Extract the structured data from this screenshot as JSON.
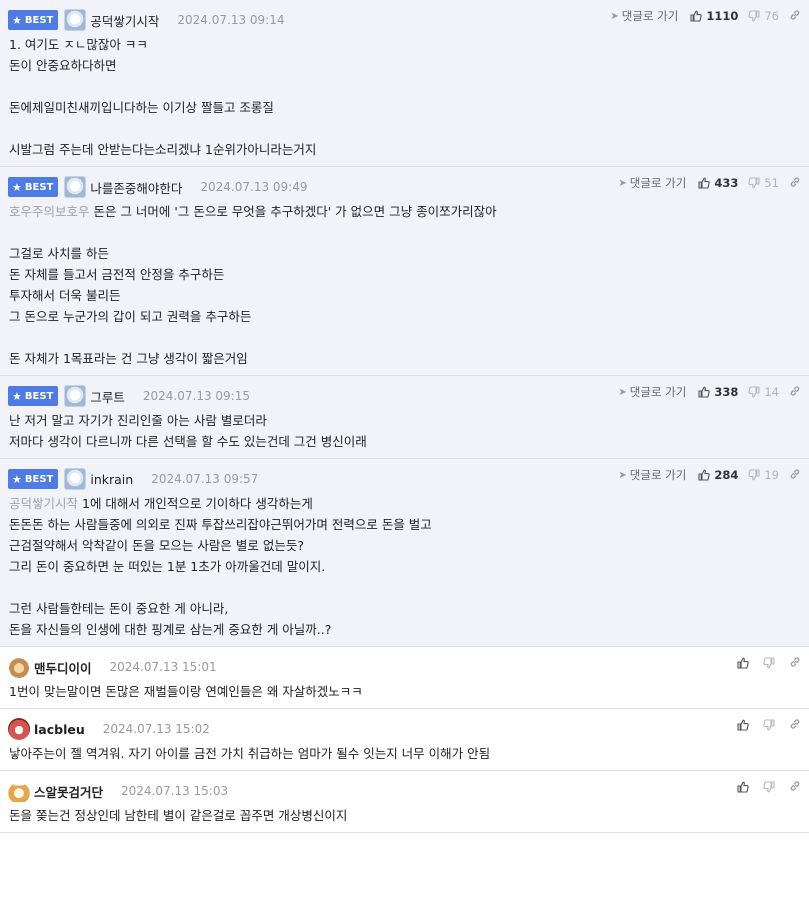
{
  "ui": {
    "best_label": "BEST",
    "goto_label": "댓글로 가기"
  },
  "comments": [
    {
      "best": true,
      "avatar": "dog-avatar",
      "nick": "공덕쌓기시작",
      "date": "2024.07.13 09:14",
      "up": "1110",
      "down": "76",
      "mention": "",
      "text": "1. 여기도 ㅈㄴ많잖아 ㅋㅋ\n돈이 안중요하다하면\n\n돈에제일미친새끼입니다하는 이기상 짤들고 조롱질\n\n시발그럼 주는데 안받는다는소리겠냐 1순위가아니라는거지"
    },
    {
      "best": true,
      "avatar": "dog-avatar",
      "nick": "나를존중해야한다",
      "date": "2024.07.13 09:49",
      "up": "433",
      "down": "51",
      "mention": "호우주의보호우",
      "text": " 돈은 그 너머에 '그 돈으로 무엇을 추구하겠다' 가 없으면 그냥 종이쪼가리잖아\n\n그걸로 사치를 하든\n돈 자체를 들고서 금전적 안정을 추구하든\n투자해서 더욱 불리든\n그 돈으로 누군가의 갑이 되고 권력을 추구하든\n\n돈 자체가 1목표라는 건 그냥 생각이 짧은거임"
    },
    {
      "best": true,
      "avatar": "dog-avatar",
      "nick": "그루트",
      "date": "2024.07.13 09:15",
      "up": "338",
      "down": "14",
      "mention": "",
      "text": "난 저거 말고 자기가 진리인줄 아는 사람 별로더라\n저마다 생각이 다르니까 다른 선택을 할 수도 있는건데 그건 병신이래"
    },
    {
      "best": true,
      "avatar": "dog-avatar",
      "nick": "inkrain",
      "date": "2024.07.13 09:57",
      "up": "284",
      "down": "19",
      "mention": "공덕쌓기시작",
      "text": " 1에 대해서 개인적으로 기이하다 생각하는게\n돈돈돈 하는 사람들중에 의외로 진짜 투잡쓰리잡야근뛰어가며 전력으로 돈을 벌고\n근검절약해서 악착같이 돈을 모으는 사람은 별로 없는듯?\n그리 돈이 중요하면 눈 떠있는 1분 1초가 아까울건데 말이지.\n\n그런 사람들한테는 돈이 중요한 게 아니라,\n돈을 자신들의 인생에 대한 핑계로 삼는게 중요한 게 아닐까..?"
    },
    {
      "best": false,
      "avatar": "bear-avatar",
      "nick": "맨두디이이",
      "date": "2024.07.13 15:01",
      "up": "",
      "down": "",
      "mention": "",
      "text": "1번이 맞는말이면 돈많은 재벌들이랑 연예인들은 왜 자살하겠노ㅋㅋ"
    },
    {
      "best": false,
      "avatar": "red-avatar",
      "nick": "lacbleu",
      "date": "2024.07.13 15:02",
      "up": "",
      "down": "",
      "mention": "",
      "text": "낳아주는이 젤 역겨워. 자기 아이를 금전 가치 취급하는 엄마가 될수 잇는지 너무 이해가 안됨"
    },
    {
      "best": false,
      "avatar": "fox-avatar",
      "nick": "스알못검거단",
      "date": "2024.07.13 15:03",
      "up": "",
      "down": "",
      "mention": "",
      "text": "돈을 쫒는건 정상인데 남한테 별이 같은걸로 꼽주면 개상병신이지"
    }
  ]
}
